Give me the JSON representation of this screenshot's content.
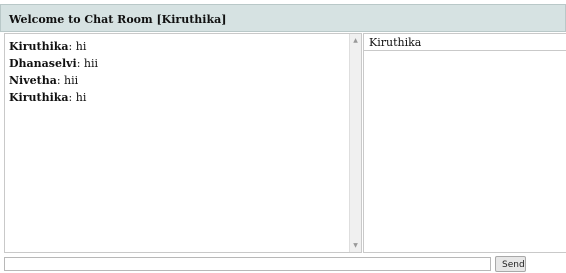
{
  "header": {
    "title": "Welcome to Chat Room [Kiruthika]"
  },
  "messages": [
    {
      "user": "Kiruthika",
      "text": ": hi"
    },
    {
      "user": "Dhanaselvi",
      "text": ": hii"
    },
    {
      "user": "Nivetha",
      "text": ": hii"
    },
    {
      "user": "Kiruthika",
      "text": ": hi"
    }
  ],
  "users_panel": {
    "header": "Kiruthika"
  },
  "composer": {
    "message_value": "",
    "send_label": "Send"
  },
  "icons": {
    "scroll_up": "scroll-up-arrow",
    "scroll_down": "scroll-down-arrow"
  },
  "colors": {
    "header_bg": "#d6e2e2",
    "border": "#c9c9c9"
  }
}
